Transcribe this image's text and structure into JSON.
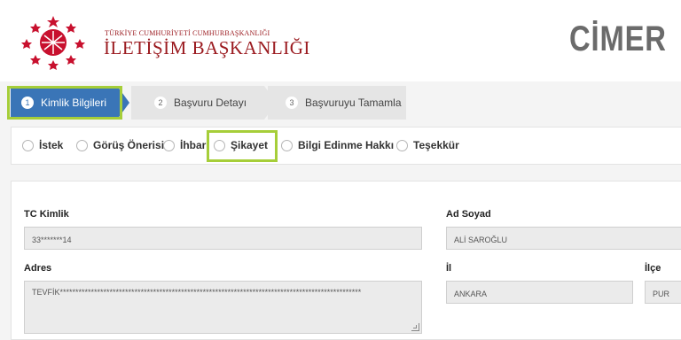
{
  "header": {
    "org_small": "TÜRKİYE CUMHURİYETİ CUMHURBAŞKANLIĞI",
    "org_big": "İLETİŞİM BAŞKANLIĞI",
    "brand": "CİMER",
    "logo_icon": "star-emblem-icon",
    "brand_color": "#c8102e"
  },
  "steps": [
    {
      "num": "1",
      "label": "Kimlik Bilgileri",
      "active": true
    },
    {
      "num": "2",
      "label": "Başvuru Detayı",
      "active": false
    },
    {
      "num": "3",
      "label": "Başvuruyu Tamamla",
      "active": false
    }
  ],
  "application_types": [
    "İstek",
    "Görüş Önerisi",
    "İhbar",
    "Şikayet",
    "Bilgi Edinme Hakkı",
    "Teşekkür"
  ],
  "form": {
    "tc_label": "TC Kimlik",
    "tc_value": "33*******14",
    "name_label": "Ad Soyad",
    "name_value": "ALİ SAROĞLU",
    "address_label": "Adres",
    "address_value": "TEVFİK*************************************************************************************************",
    "il_label": "İl",
    "il_value": "ANKARA",
    "ilce_label": "İlçe",
    "ilce_value": "PUR"
  },
  "colors": {
    "active_step": "#3a75b7",
    "highlight": "#a6ce39",
    "brand_red": "#c8102e"
  }
}
